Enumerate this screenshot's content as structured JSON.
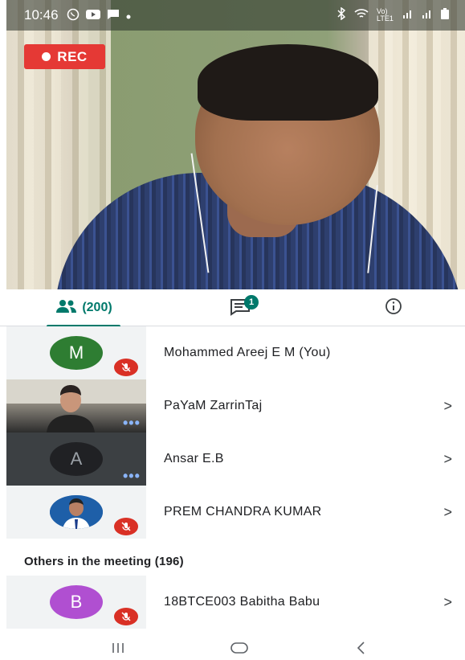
{
  "status_bar": {
    "time": "10:46",
    "network_label": "Vo) LTE1",
    "icons_left": [
      "whatsapp-icon",
      "youtube-icon",
      "message-icon",
      "dot-icon"
    ],
    "icons_right": [
      "bluetooth-icon",
      "wifi-icon",
      "signal-icon",
      "signal-icon",
      "battery-icon"
    ]
  },
  "video": {
    "rec_label": "REC",
    "rec_color": "#e53935"
  },
  "tabs": {
    "people_count": "(200)",
    "chat_badge": "1",
    "accent": "#00796b"
  },
  "participants": [
    {
      "name": "Mohammed Areej E M (You)",
      "avatar_letter": "M",
      "avatar_color": "#2e7d32",
      "muted": true,
      "has_chevron": false
    },
    {
      "name": "PaYaM ZarrinTaj",
      "avatar_letter": "",
      "avatar_color": "",
      "muted": false,
      "has_chevron": true
    },
    {
      "name": "Ansar E.B",
      "avatar_letter": "A",
      "avatar_color": "#202124",
      "muted": false,
      "has_chevron": true
    },
    {
      "name": "PREM CHANDRA KUMAR",
      "avatar_letter": "",
      "avatar_color": "",
      "muted": true,
      "has_chevron": true
    }
  ],
  "others": {
    "title": "Others in the meeting (196)",
    "participants": [
      {
        "name": "18BTCE003 Babitha Babu",
        "avatar_letter": "B",
        "avatar_color": "#b04fd1",
        "muted": true,
        "has_chevron": true
      }
    ]
  },
  "chevron_glyph": ">",
  "nav": {
    "icons": [
      "recent-apps-icon",
      "home-icon",
      "back-icon"
    ]
  }
}
